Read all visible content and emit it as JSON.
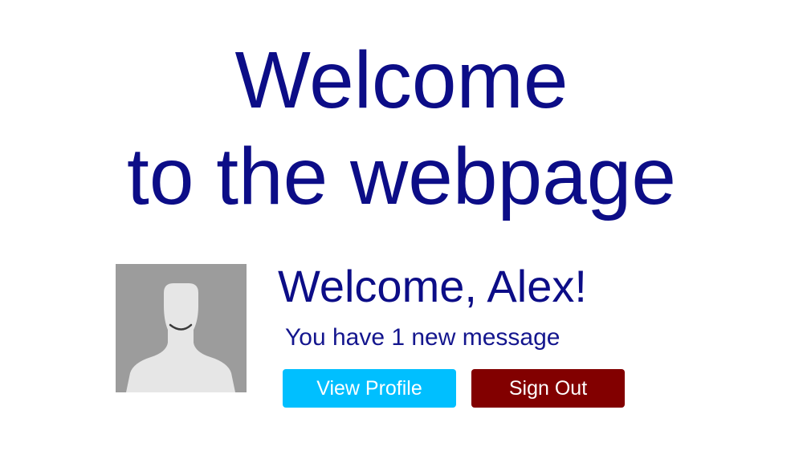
{
  "hero": {
    "line1": "Welcome",
    "line2": "to the webpage"
  },
  "user_card": {
    "avatar_icon": "person-silhouette-icon",
    "greeting": "Welcome, Alex!",
    "message": "You have 1 new message",
    "view_profile_label": "View Profile",
    "sign_out_label": "Sign Out"
  },
  "colors": {
    "heading": "#0c0d87",
    "avatar_background": "#9c9c9c",
    "view_profile_button": "#00bfff",
    "sign_out_button": "#820000"
  }
}
